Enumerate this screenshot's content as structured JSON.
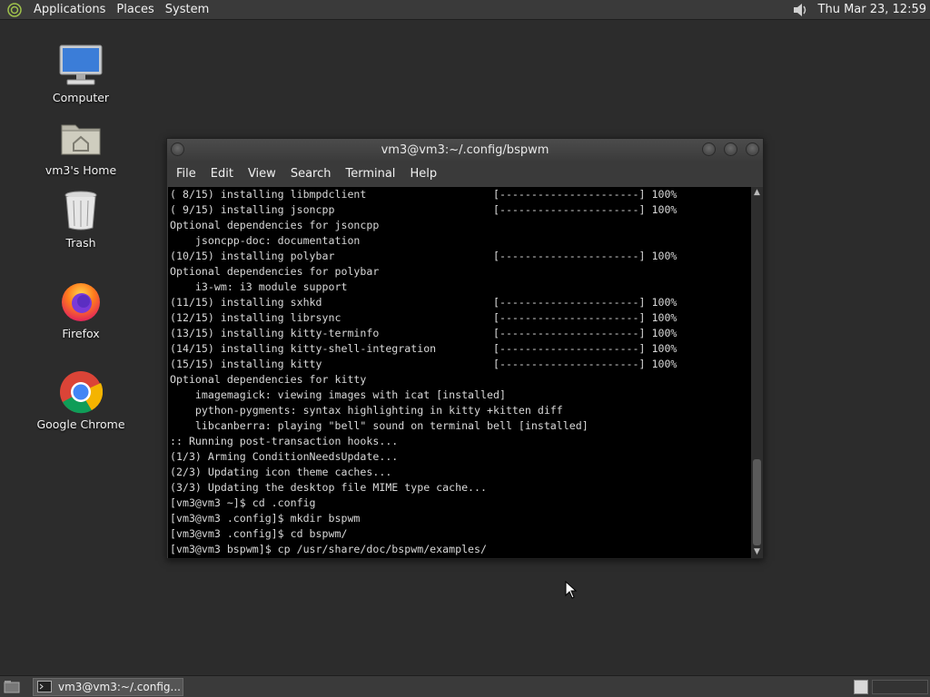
{
  "top_panel": {
    "menus": [
      "Applications",
      "Places",
      "System"
    ],
    "clock": "Thu Mar 23, 12:59"
  },
  "desktop_icons": [
    {
      "label": "Computer"
    },
    {
      "label": "vm3's Home"
    },
    {
      "label": "Trash"
    },
    {
      "label": "Firefox"
    },
    {
      "label": "Google Chrome"
    }
  ],
  "terminal": {
    "title": "vm3@vm3:~/.config/bspwm",
    "menu": [
      "File",
      "Edit",
      "View",
      "Search",
      "Terminal",
      "Help"
    ],
    "lines": [
      "( 8/15) installing libmpdclient                    [----------------------] 100%",
      "( 9/15) installing jsoncpp                         [----------------------] 100%",
      "Optional dependencies for jsoncpp",
      "    jsoncpp-doc: documentation",
      "(10/15) installing polybar                         [----------------------] 100%",
      "Optional dependencies for polybar",
      "    i3-wm: i3 module support",
      "(11/15) installing sxhkd                           [----------------------] 100%",
      "(12/15) installing librsync                        [----------------------] 100%",
      "(13/15) installing kitty-terminfo                  [----------------------] 100%",
      "(14/15) installing kitty-shell-integration         [----------------------] 100%",
      "(15/15) installing kitty                           [----------------------] 100%",
      "Optional dependencies for kitty",
      "    imagemagick: viewing images with icat [installed]",
      "    python-pygments: syntax highlighting in kitty +kitten diff",
      "    libcanberra: playing \"bell\" sound on terminal bell [installed]",
      ":: Running post-transaction hooks...",
      "(1/3) Arming ConditionNeedsUpdate...",
      "(2/3) Updating icon theme caches...",
      "(3/3) Updating the desktop file MIME type cache...",
      "[vm3@vm3 ~]$ cd .config",
      "[vm3@vm3 .config]$ mkdir bspwm",
      "[vm3@vm3 .config]$ cd bspwm/",
      "[vm3@vm3 bspwm]$ cp /usr/share/doc/bspwm/examples/"
    ]
  },
  "taskbar": {
    "task_label": "vm3@vm3:~/.config..."
  },
  "colors": {
    "desktop_bg": "#2c2c2c",
    "panel_bg": "#3a3a3a",
    "terminal_bg": "#000000",
    "terminal_fg": "#d8d8d8"
  }
}
